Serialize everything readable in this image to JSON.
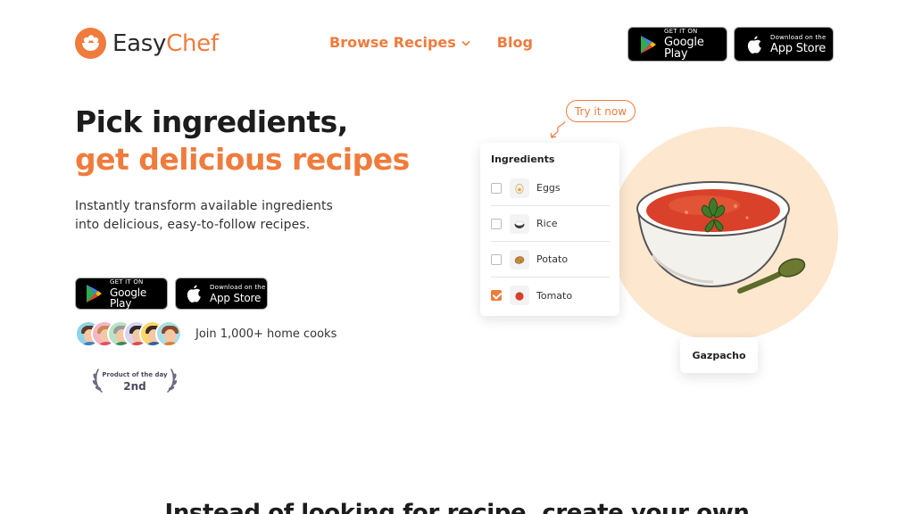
{
  "brand": {
    "name_part1": "Easy",
    "name_part2": "Chef",
    "accent": "#ef7b3c"
  },
  "nav": {
    "browse_label": "Browse Recipes",
    "blog_label": "Blog"
  },
  "stores": {
    "google_small": "GET IT ON",
    "google_big": "Google Play",
    "apple_small": "Download on the",
    "apple_big": "App Store"
  },
  "hero": {
    "headline_line1": "Pick ingredients,",
    "headline_line2": "get delicious recipes",
    "subtitle_line1": "Instantly transform available ingredients",
    "subtitle_line2": "into delicious, easy-to-follow recipes.",
    "social_proof": "Join 1,000+ home cooks",
    "badge_line1": "Product of the day",
    "badge_line2": "2nd"
  },
  "demo": {
    "try_label": "Try it now",
    "panel_title": "Ingredients",
    "ingredients": [
      {
        "label": "Eggs",
        "checked": false,
        "icon": "egg-icon"
      },
      {
        "label": "Rice",
        "checked": false,
        "icon": "rice-icon"
      },
      {
        "label": "Potato",
        "checked": false,
        "icon": "potato-icon"
      },
      {
        "label": "Tomato",
        "checked": true,
        "icon": "tomato-icon"
      }
    ],
    "recipe_name": "Gazpacho"
  },
  "section2": {
    "heading": "Instead of looking for recipe, create your own"
  }
}
